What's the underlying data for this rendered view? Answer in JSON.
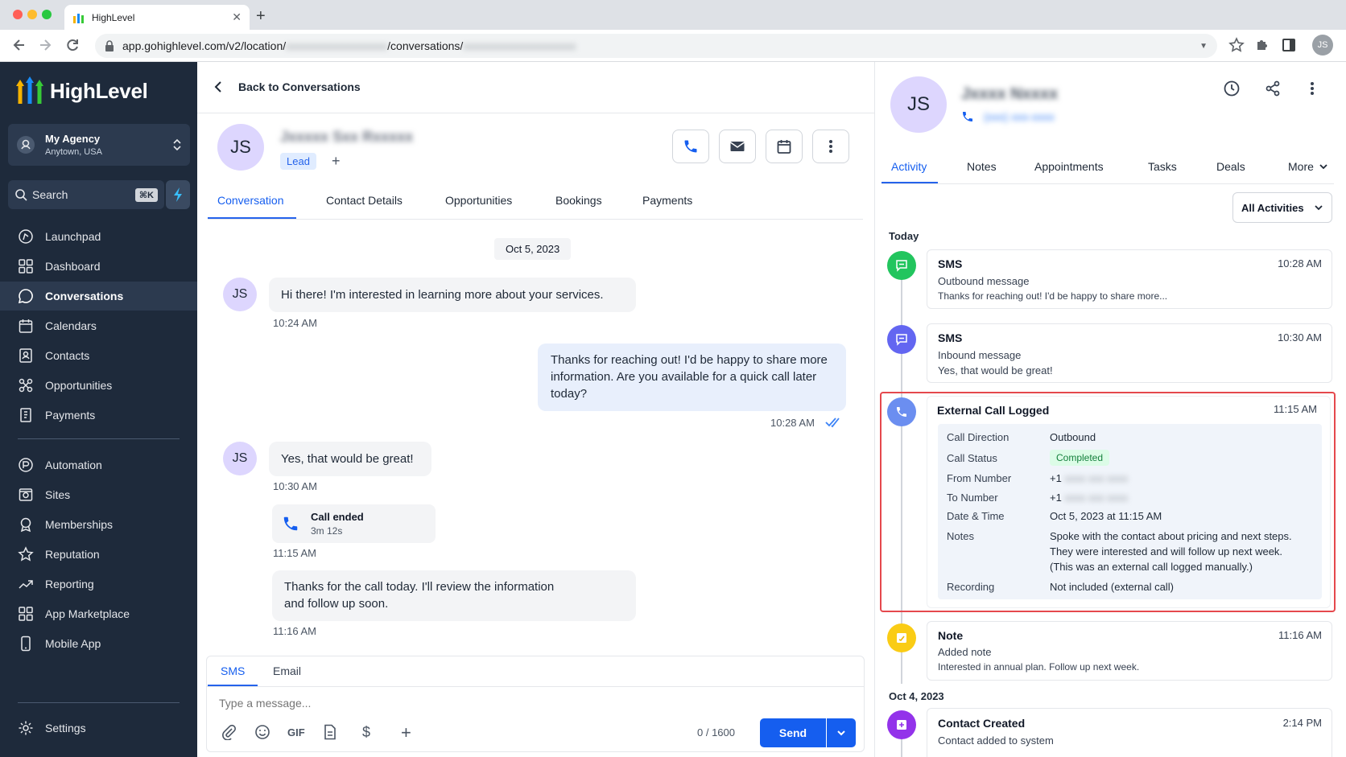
{
  "browser": {
    "tab_title": "HighLevel",
    "url_prefix": "app.gohighlevel.com/v2/location/",
    "url_hidden_1": "xxxxxxxxxxxxxxxxxx",
    "url_middle": "/conversations/",
    "url_hidden_2": "xxxxxxxxxxxxxxxxxxxx",
    "profile_initials": "JS"
  },
  "sidebar": {
    "logo_text": "HighLevel",
    "agency_name": "My Agency",
    "agency_location": "Anytown, USA",
    "search_label": "Search",
    "search_shortcut": "⌘K",
    "items": [
      {
        "label": "Launchpad"
      },
      {
        "label": "Dashboard"
      },
      {
        "label": "Conversations"
      },
      {
        "label": "Calendars"
      },
      {
        "label": "Contacts"
      },
      {
        "label": "Opportunities"
      },
      {
        "label": "Payments"
      },
      {
        "label": "Automation"
      },
      {
        "label": "Sites"
      },
      {
        "label": "Memberships"
      },
      {
        "label": "Reputation"
      },
      {
        "label": "Reporting"
      },
      {
        "label": "App Marketplace"
      },
      {
        "label": "Mobile App"
      }
    ],
    "settings_label": "Settings",
    "colors": {
      "bg": "#1e2a3b",
      "active": "#2c3a4f"
    }
  },
  "conversation": {
    "back_label": "Back to Conversations",
    "contact_initials": "JS",
    "contact_name_hidden": "Jxxxxx Sxx Rxxxxx",
    "tag": "Lead",
    "tabs": [
      "Conversation",
      "Contact Details",
      "Opportunities",
      "Bookings",
      "Payments"
    ],
    "date_chip": "Oct 5, 2023",
    "messages": [
      {
        "text": "Hi there! I'm interested in learning more about your services.",
        "time": "10:24 AM"
      },
      {
        "text": "Thanks for reaching out! I'd be happy to share more information. Are you available for a quick call later today?",
        "time": "10:28 AM"
      },
      {
        "text": "Yes, that would be great!",
        "time": "10:30 AM"
      },
      {
        "text": "Call ended",
        "sub": "3m 12s",
        "time": "11:15 AM"
      },
      {
        "text": "Thanks for the call today. I'll review the information and follow up soon.",
        "time": "11:16 AM"
      }
    ],
    "composer": {
      "tabs": [
        "SMS",
        "Email"
      ],
      "placeholder": "Type a message...",
      "gif_label": "GIF",
      "counter": "0 / 1600",
      "send_label": "Send"
    },
    "accent": "#155eef"
  },
  "activity": {
    "contact_initials": "JS",
    "name_hidden": "Jxxxx Nxxxx",
    "phone_hidden": "(xxx) xxx-xxxx",
    "tabs": [
      "Activity",
      "Notes",
      "Appointments",
      "Tasks",
      "Deals",
      "More"
    ],
    "filter_label": "All Activities",
    "groups": {
      "today": "Today",
      "older": "Oct 4, 2023"
    },
    "items": [
      {
        "title": "SMS",
        "sub": "Outbound message",
        "desc": "Thanks for reaching out! I'd be happy to share more...",
        "time": "10:28 AM",
        "color": "#22c55e"
      },
      {
        "title": "SMS",
        "sub": "Inbound message",
        "desc": "Yes, that would be great!",
        "time": "10:30 AM",
        "color": "#6366f1"
      },
      {
        "title": "External Call Logged",
        "time": "11:15 AM",
        "color": "#6b8ef0"
      },
      {
        "title": "Note",
        "sub": "Added note",
        "desc": "Interested in annual plan. Follow up next week.",
        "time": "11:16 AM",
        "color": "#facc15"
      },
      {
        "title": "Contact Created",
        "sub": "Contact added to system",
        "time": "2:14 PM",
        "color": "#9333ea"
      }
    ],
    "call_details": {
      "direction_label": "Call Direction",
      "direction": "Outbound",
      "status_label": "Call Status",
      "status": "Completed",
      "from_label": "From Number",
      "from_prefix": "+1",
      "from_hidden": "xxxx xxx xxxx",
      "to_label": "To Number",
      "to_prefix": "+1",
      "to_hidden": "xxxx xxx xxxx",
      "datetime_label": "Date & Time",
      "datetime": "Oct 5, 2023 at 11:15 AM",
      "notes_label": "Notes",
      "notes_1": "Spoke with the contact about pricing and next steps.",
      "notes_2": "They were interested and will follow up next week.",
      "notes_3": "(This was an external call logged manually.)",
      "recording_label": "Recording",
      "recording": "Not included (external call)"
    },
    "highlight_color": "#e5484d"
  }
}
